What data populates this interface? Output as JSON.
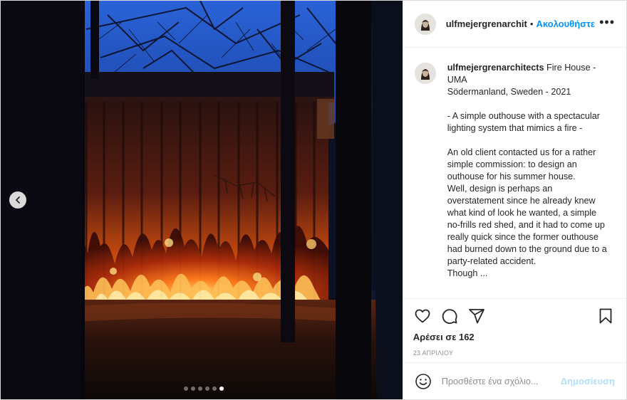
{
  "post": {
    "username": "ulfmejergrenarchit",
    "separator": "•",
    "follow_label": "Ακολουθήστε",
    "more_icon": "more-horizontal-icon",
    "more_label": "•••"
  },
  "caption": {
    "username": "ulfmejergrenarchitects",
    "lines": [
      " Fire House - UMA",
      "Södermanland, Sweden - 2021",
      "- A simple outhouse with a spectacular lighting system that mimics a fire -",
      "An old client contacted us for a rather simple commission: to design an outhouse for his summer house.",
      "Well, design is perhaps an overstatement since he already knew what kind of look he wanted, a simple no-frills red shed, and it had to come up really quick since the former outhouse had burned down to the ground due to a party-related accident.",
      "Though ..."
    ]
  },
  "actions": {
    "like_icon": "heart-icon",
    "comment_icon": "comment-icon",
    "share_icon": "share-icon",
    "save_icon": "bookmark-icon",
    "likes_text": "Αρέσει σε 162",
    "date": "23 ΑΠΡΙΛΙΟΥ"
  },
  "comment_box": {
    "emoji_icon": "emoji-icon",
    "placeholder": "Προσθέστε ένα σχόλιο...",
    "post_label": "Δημοσίευση"
  },
  "carousel": {
    "prev_icon": "chevron-left-icon",
    "total_slides": 6,
    "active_slide": 6
  },
  "colors": {
    "accent": "#0095f6",
    "post_disabled": "#b2dffc",
    "sky": "#1f4fb8",
    "fire": "#ff6a1a"
  }
}
